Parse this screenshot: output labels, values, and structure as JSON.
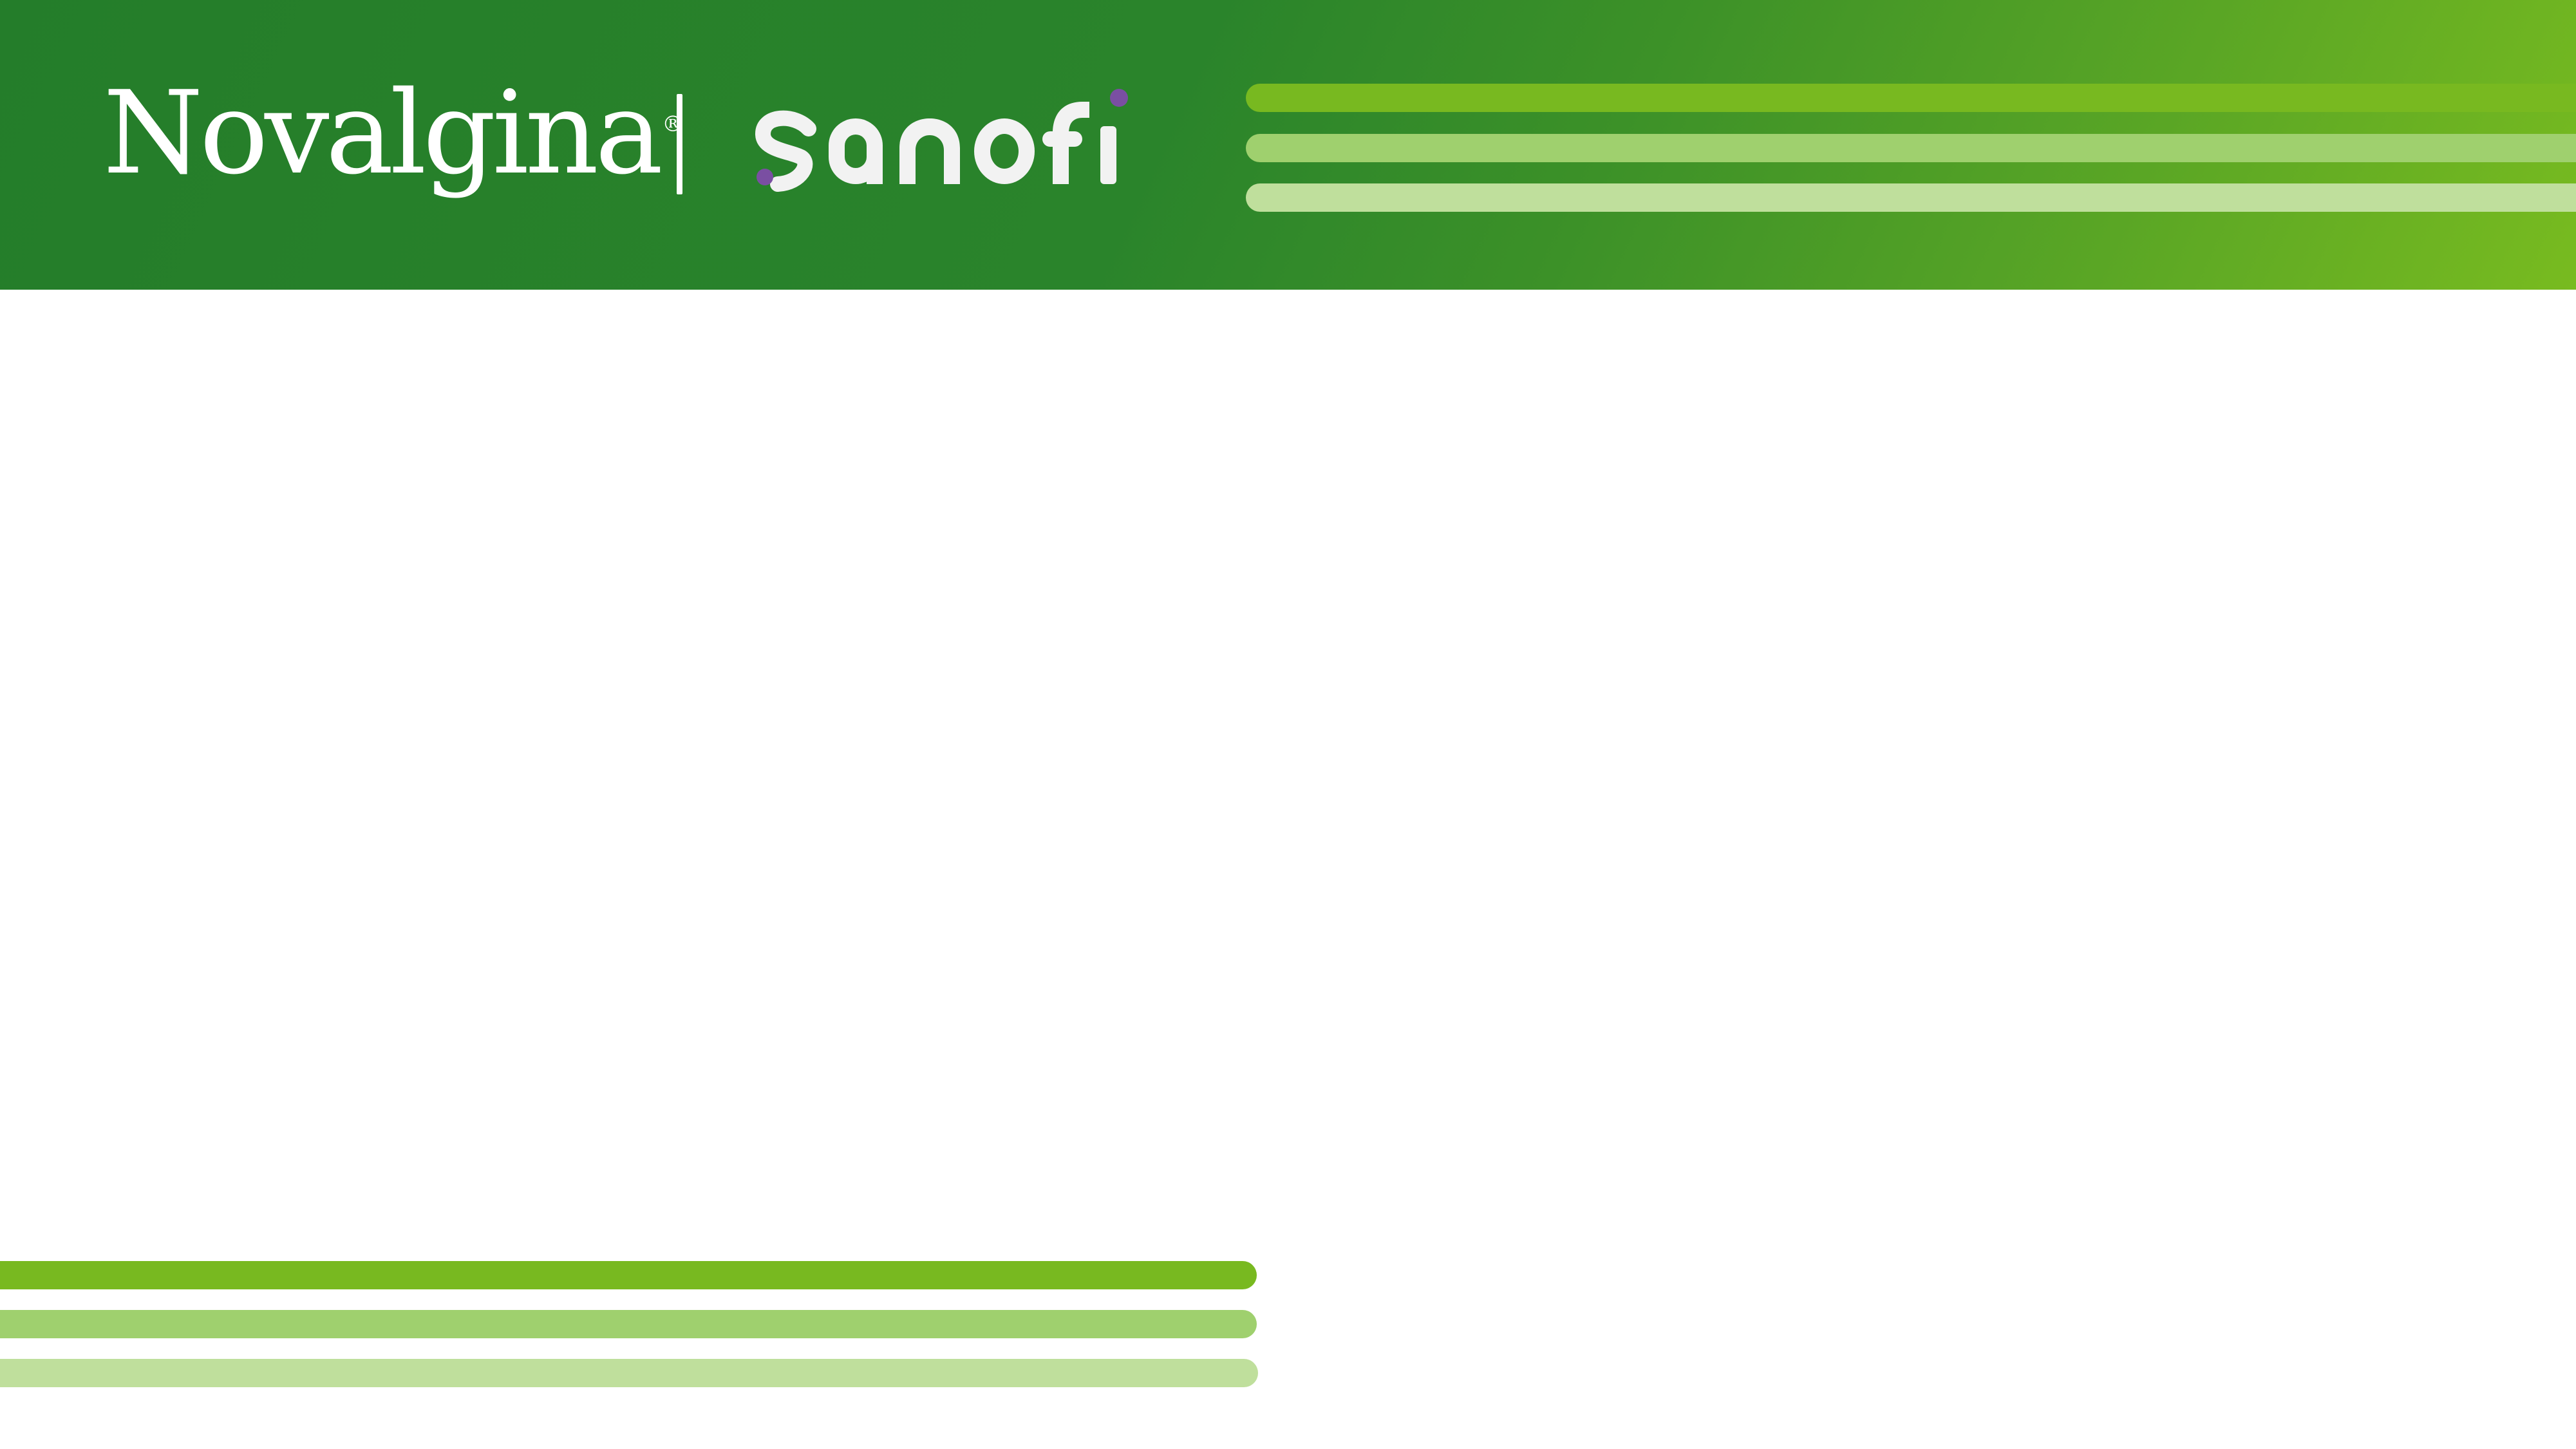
{
  "brand": {
    "novalgina": "Novalgina",
    "registered_mark": "®",
    "sanofi": "sanofi",
    "sanofi_dot_color": "#7a4fa2"
  },
  "colors": {
    "header_green_dark": "#247d2a",
    "header_green_light": "#78bb20",
    "stripe_1": "#78b920",
    "stripe_2": "#9fd06e",
    "stripe_3": "#bfdf9c"
  }
}
